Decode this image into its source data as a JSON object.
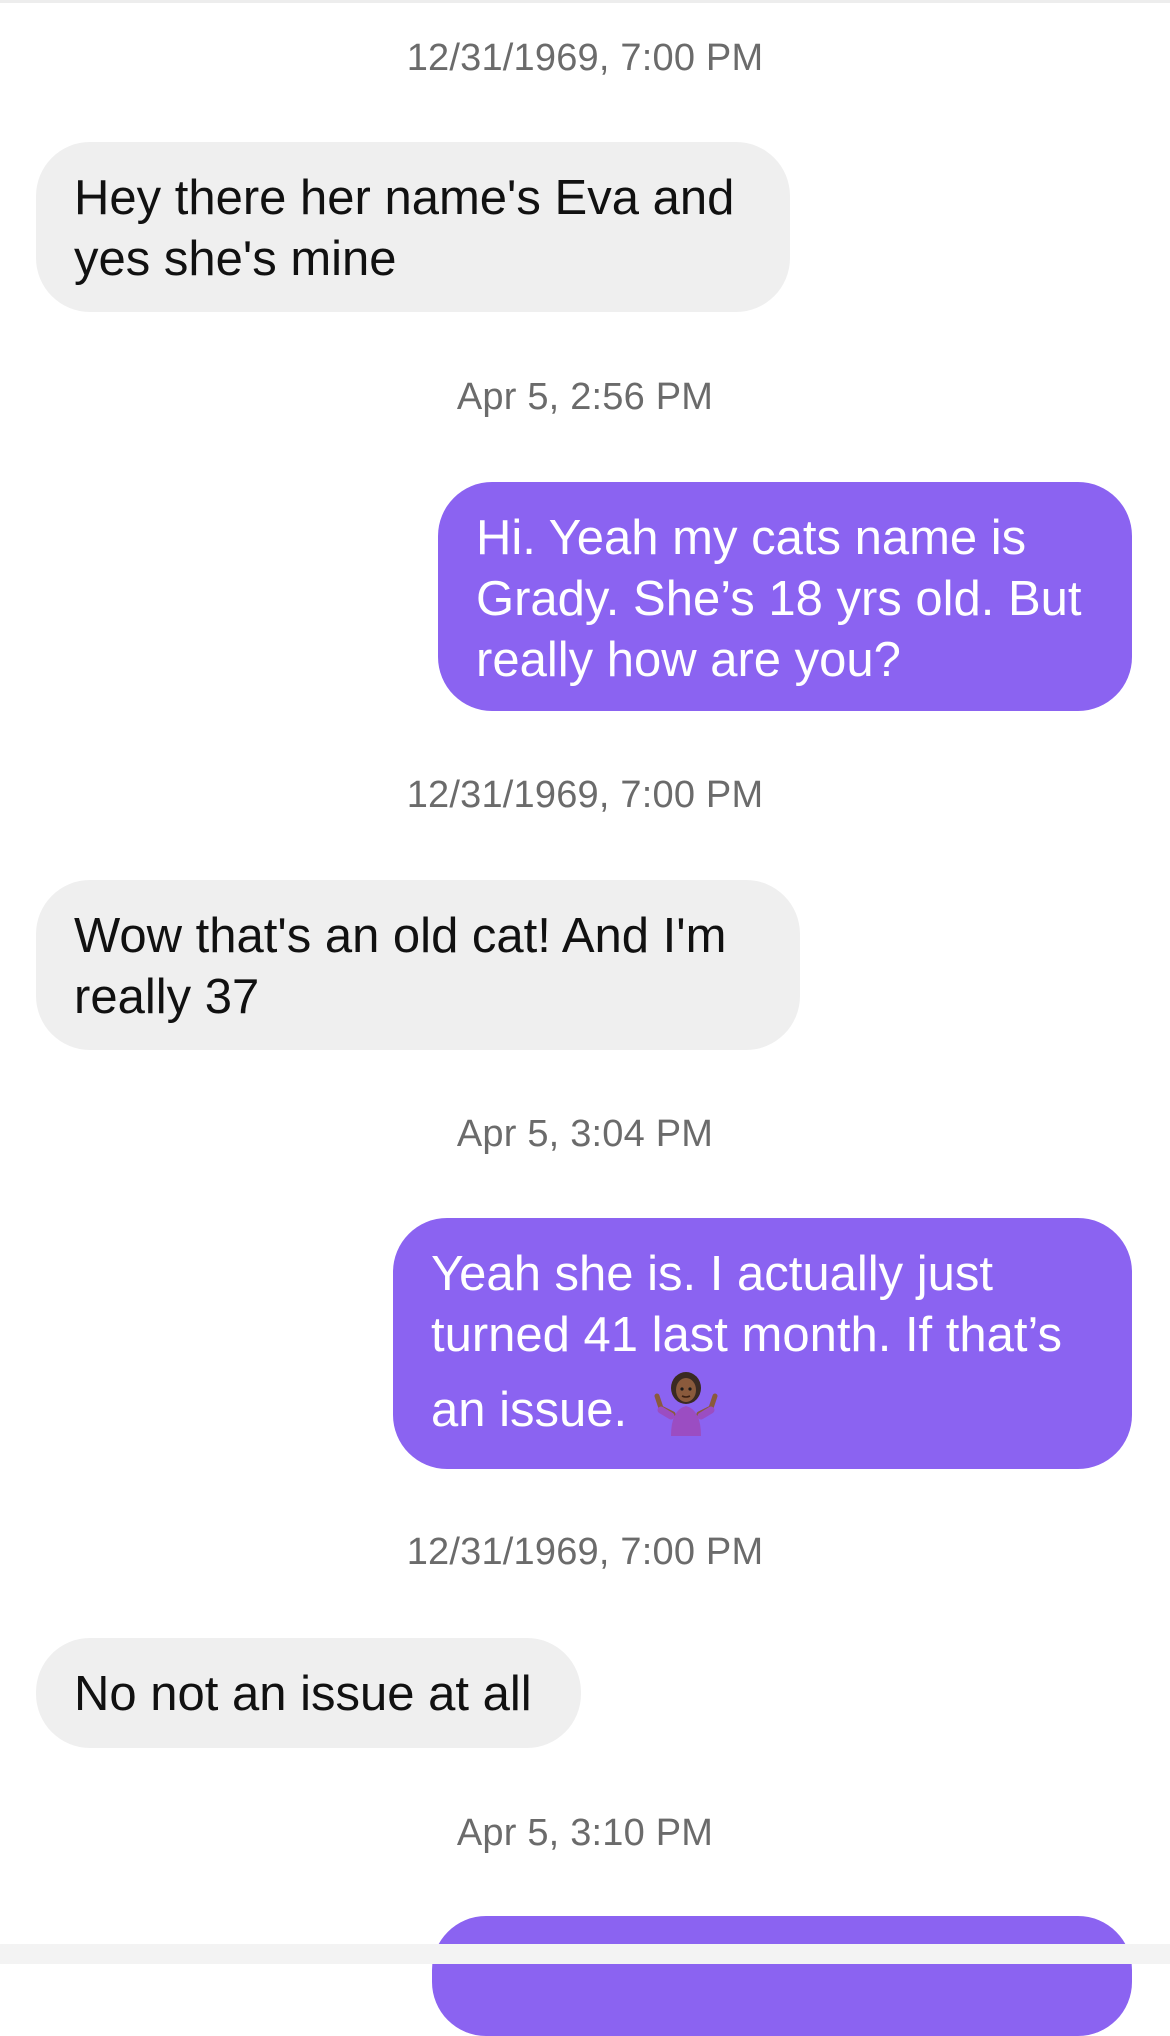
{
  "conversation": {
    "items": [
      {
        "kind": "timestamp",
        "text": "12/31/1969, 7:00 PM"
      },
      {
        "kind": "incoming",
        "text": "Hey there her name's Eva and yes she's mine"
      },
      {
        "kind": "timestamp",
        "text": "Apr 5, 2:56 PM"
      },
      {
        "kind": "outgoing",
        "text": "Hi. Yeah my cats name is Grady. She’s 18 yrs old. But really how are you?"
      },
      {
        "kind": "timestamp",
        "text": "12/31/1969, 7:00 PM"
      },
      {
        "kind": "incoming",
        "text": "Wow that's an old cat! And I'm really 37"
      },
      {
        "kind": "timestamp",
        "text": "Apr 5, 3:04 PM"
      },
      {
        "kind": "outgoing",
        "text": "Yeah she is. I actually just turned 41 last month. If that’s an issue.",
        "emoji": "person-shrugging-icon"
      },
      {
        "kind": "timestamp",
        "text": "12/31/1969, 7:00 PM"
      },
      {
        "kind": "incoming",
        "text": "No not an issue at all"
      },
      {
        "kind": "timestamp",
        "text": "Apr 5, 3:10 PM"
      },
      {
        "kind": "outgoing",
        "text": ""
      }
    ]
  },
  "colors": {
    "incoming_bubble": "#efefef",
    "outgoing_bubble": "#8b63f1",
    "timestamp_text": "#6b6b6b"
  }
}
